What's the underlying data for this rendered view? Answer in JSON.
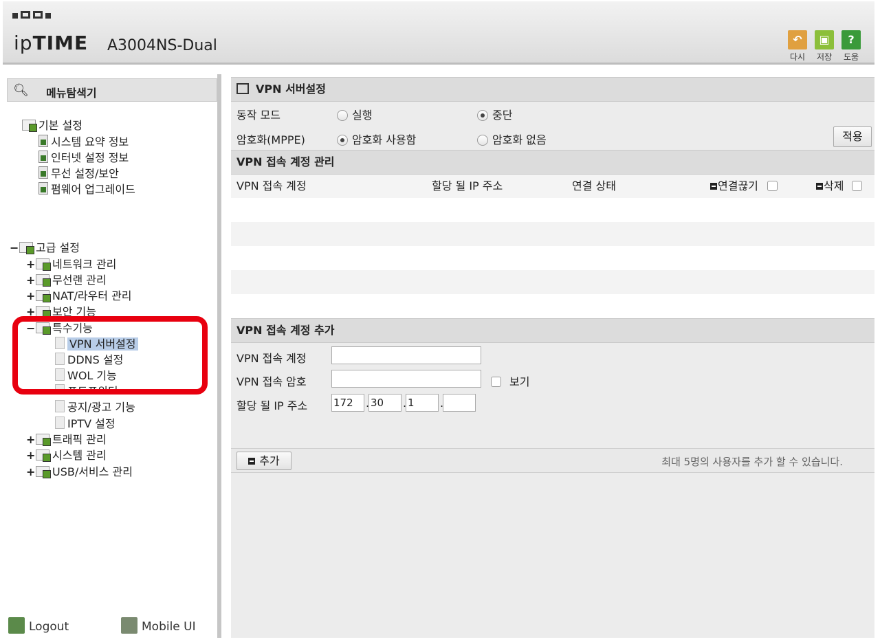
{
  "header": {
    "brand_prefix": "ip",
    "brand_main": "TIME",
    "model": "A3004NS-Dual",
    "buttons": [
      {
        "label": "다시",
        "icon": "undo-icon",
        "color": "#e0a040"
      },
      {
        "label": "저장",
        "icon": "save-icon",
        "color": "#8cbf3a"
      },
      {
        "label": "도움",
        "icon": "help-icon",
        "color": "#3a9a3a",
        "glyph": "?"
      }
    ]
  },
  "sidebar": {
    "search_label": "메뉴탐색기",
    "basic": {
      "label": "기본 설정",
      "items": [
        "시스템 요약 정보",
        "인터넷 설정 정보",
        "무선 설정/보안",
        "펌웨어 업그레이드"
      ]
    },
    "advanced": {
      "toggle": "−",
      "label": "고급 설정",
      "groups": [
        {
          "toggle": "+",
          "label": "네트워크 관리"
        },
        {
          "toggle": "+",
          "label": "무선랜 관리"
        },
        {
          "toggle": "+",
          "label": "NAT/라우터 관리"
        },
        {
          "toggle": "+",
          "label": "보안 기능"
        },
        {
          "toggle": "−",
          "label": "특수기능"
        }
      ],
      "special_items": [
        "VPN 서버설정",
        "DDNS 설정",
        "WOL 기능",
        "포트포워딩",
        "공지/광고 기능",
        "IPTV 설정"
      ],
      "more_groups": [
        {
          "toggle": "+",
          "label": "트래픽 관리"
        },
        {
          "toggle": "+",
          "label": "시스템 관리"
        },
        {
          "toggle": "+",
          "label": "USB/서비스 관리"
        }
      ]
    },
    "footer": {
      "logout": "Logout",
      "mobile": "Mobile UI"
    }
  },
  "main": {
    "title": "VPN 서버설정",
    "mode": {
      "label": "동작 모드",
      "option_run": "실행",
      "option_stop": "중단",
      "selected": "중단"
    },
    "encryption": {
      "label": "암호화(MPPE)",
      "option_use": "암호화 사용함",
      "option_none": "암호화 없음",
      "selected": "암호화 사용함"
    },
    "apply_label": "적용",
    "accounts": {
      "title": "VPN 접속 계정 관리",
      "columns": [
        "VPN 접속 계정",
        "할당 될 IP 주소",
        "연결 상태",
        "연결끊기",
        "삭제"
      ],
      "rows": []
    },
    "add": {
      "title": "VPN 접속 계정 추가",
      "account_label": "VPN 접속 계정",
      "account_value": "",
      "password_label": "VPN 접속 암호",
      "password_value": "",
      "show_label": "보기",
      "ip_label": "할당 될 IP 주소",
      "ip": [
        "172",
        "30",
        "1",
        ""
      ],
      "add_button": "추가",
      "note": "최대 5명의 사용자를 추가 할 수 있습니다."
    }
  }
}
